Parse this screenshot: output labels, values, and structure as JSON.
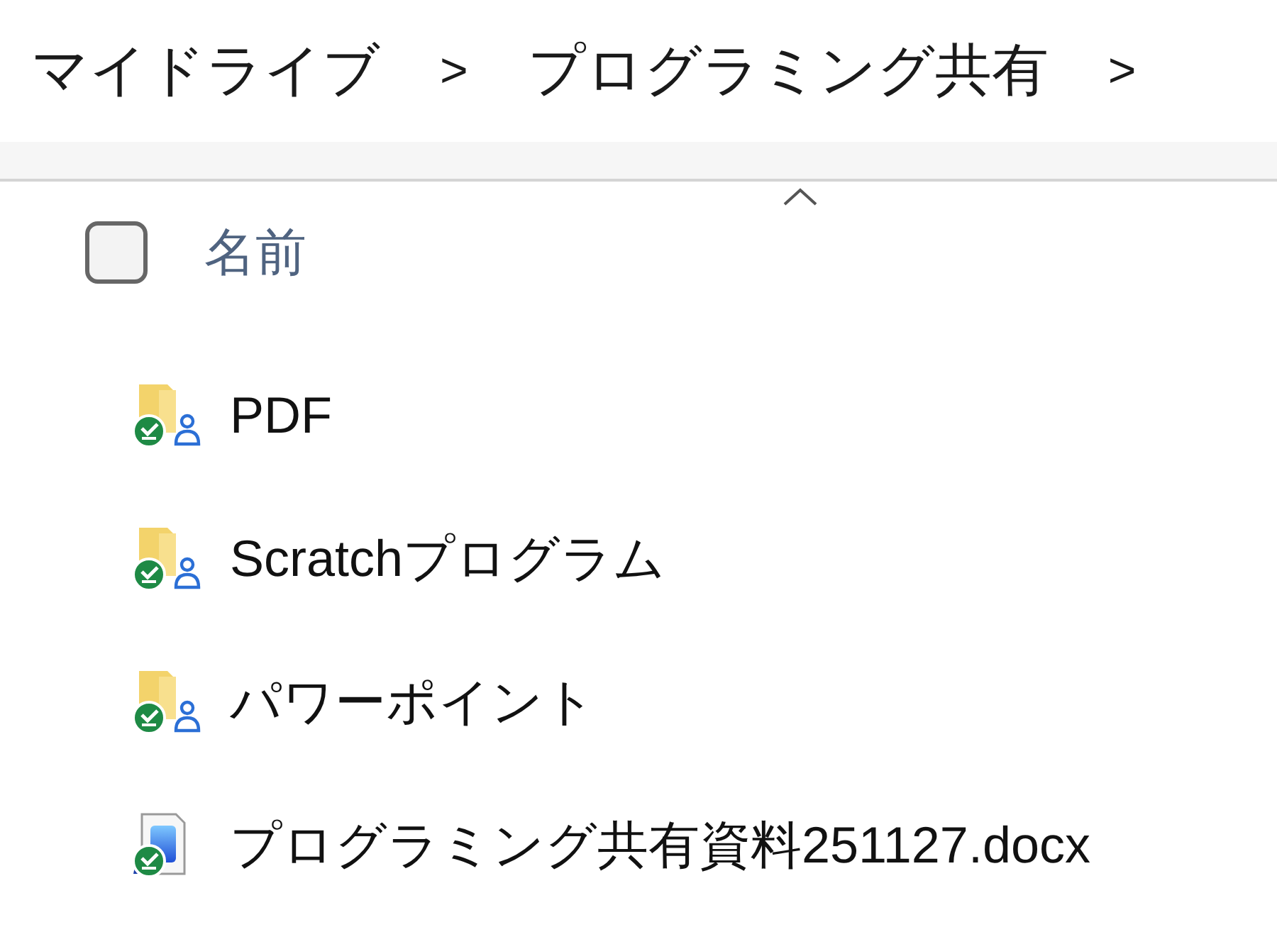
{
  "breadcrumb": [
    {
      "label": "マイドライブ",
      "separator": ">"
    },
    {
      "label": "プログラミング共有",
      "separator": ">"
    }
  ],
  "column_header": {
    "checked": false,
    "label": "名前",
    "sort_ascending": true
  },
  "files": [
    {
      "name": "PDF",
      "kind": "folder"
    },
    {
      "name": "Scratchプログラム",
      "kind": "folder"
    },
    {
      "name": "パワーポイント",
      "kind": "folder"
    },
    {
      "name": "プログラミング共有資料251127.docx",
      "kind": "document"
    }
  ]
}
